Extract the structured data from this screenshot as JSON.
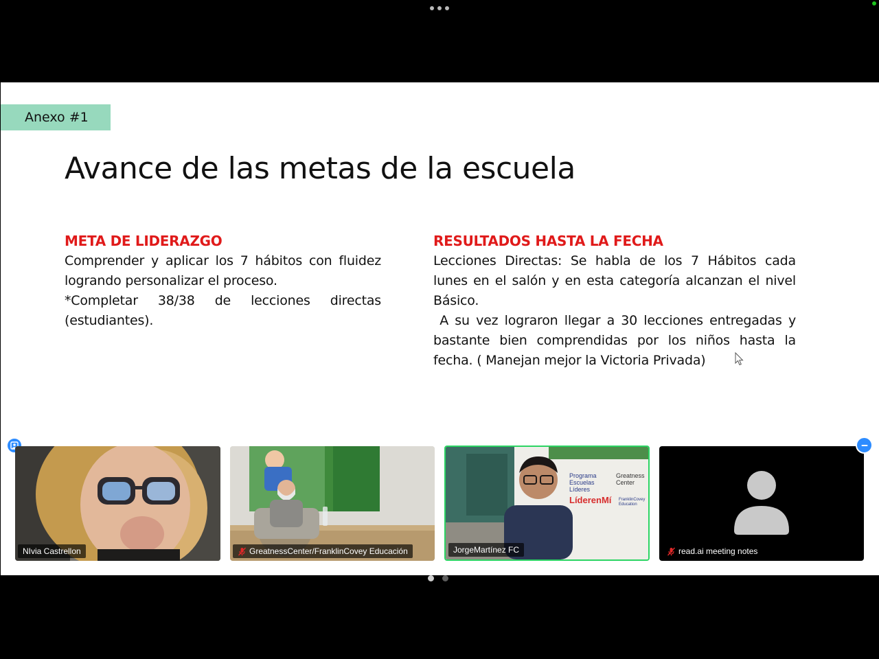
{
  "slide": {
    "tag": "Anexo #1",
    "title": "Avance de las metas de la escuela",
    "left_heading": "META DE LIDERAZGO",
    "left_paragraphs": [
      "Comprender y aplicar los 7 hábitos con fluidez logrando personalizar el proceso.",
      "*Completar 38/38 de lecciones directas (estudiantes)."
    ],
    "right_heading": "RESULTADOS HASTA LA FECHA",
    "right_paragraphs": [
      "Lecciones Directas: Se habla de los 7 Hábitos cada lunes en el salón y en esta categoría alcanzan el nivel Básico.",
      " A su vez lograron llegar a 30 lecciones entregadas y bastante bien comprendidas por los niños hasta la fecha. ( Manejan mejor la Victoria Privada)"
    ]
  },
  "participants": [
    {
      "name": "NIvia Castrellon",
      "muted": false
    },
    {
      "name": "GreatnessCenter/FranklinCovey Educación",
      "muted": true
    },
    {
      "name": "JorgeMartínez FC",
      "muted": false,
      "active_speaker": true
    },
    {
      "name": "read.ai meeting notes",
      "muted": true
    }
  ],
  "backdrop_logos": {
    "program": [
      "Programa",
      "Escuelas",
      "Líderes"
    ],
    "greatness": [
      "Greatness",
      "Center"
    ],
    "lider": "LíderenMí",
    "franklin": [
      "FranklinCovey",
      "Education"
    ]
  },
  "pagination": {
    "pages": 2,
    "current": 1
  },
  "colors": {
    "accent_red": "#e01a1a",
    "tag_green": "#97d9bd",
    "active_speaker_border": "#2bd463",
    "zoom_blue": "#2d8cff"
  },
  "icons": {
    "more": "more-dots-icon",
    "mute": "mic-muted-icon",
    "avatar": "user-avatar-icon",
    "gallery": "gallery-view-icon",
    "minimize": "minimize-icon"
  }
}
